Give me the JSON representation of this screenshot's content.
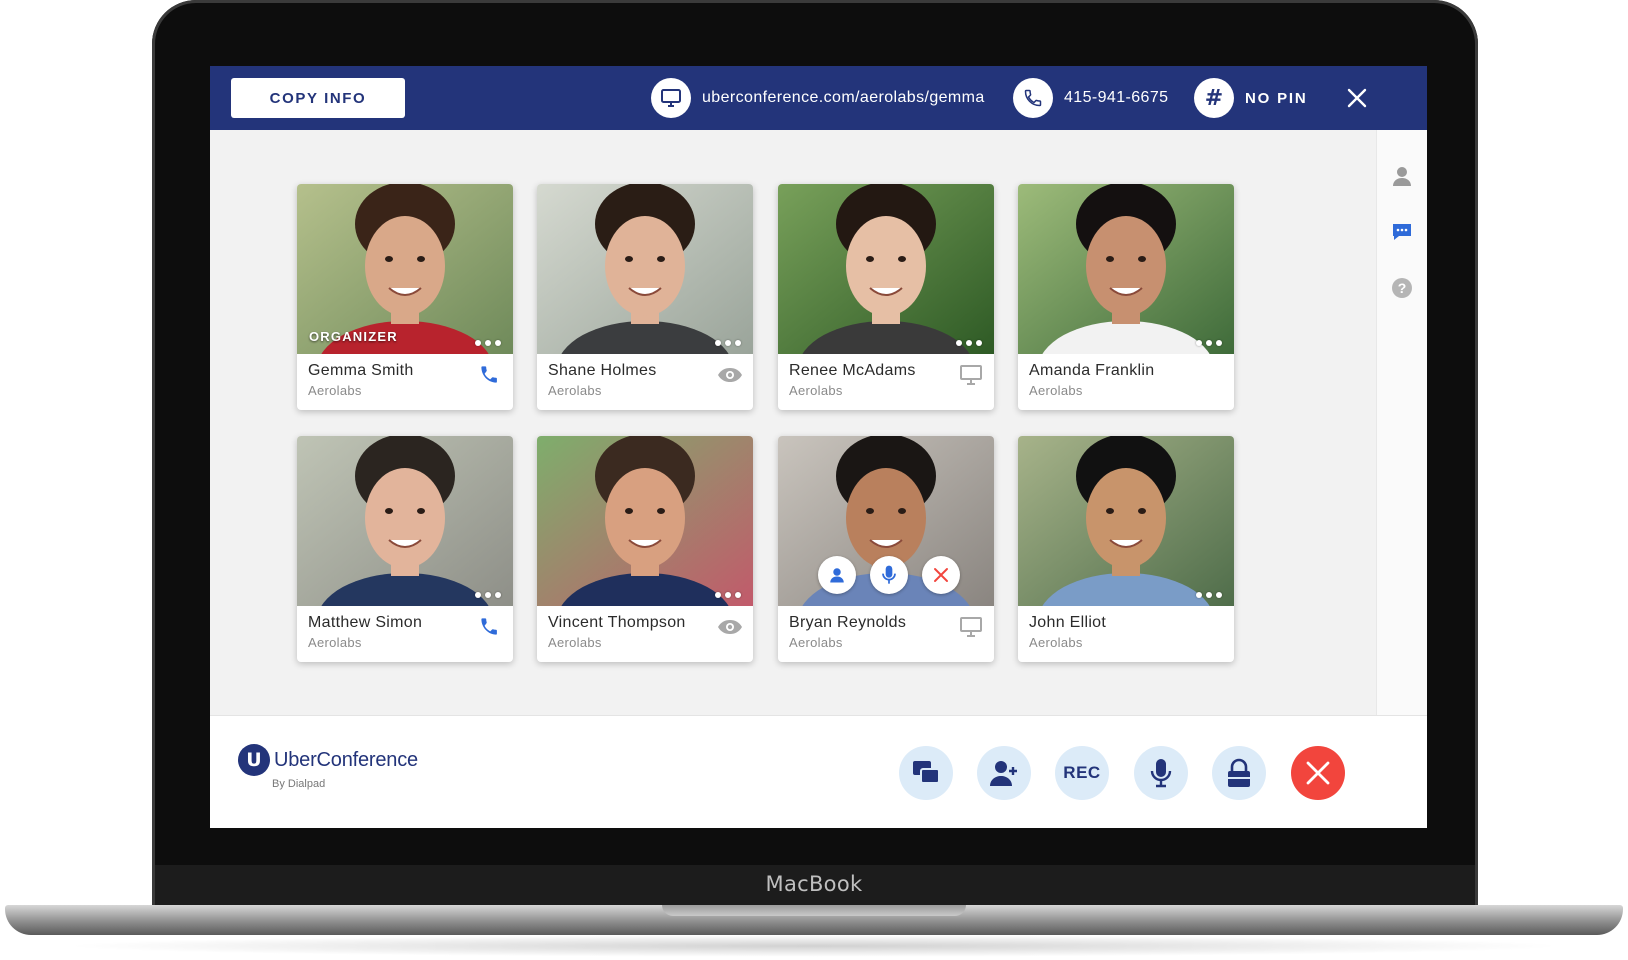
{
  "device": {
    "brand": "MacBook"
  },
  "topbar": {
    "copy_info_label": "COPY INFO",
    "url": "uberconference.com/aerolabs/gemma",
    "phone": "415-941-6675",
    "pin": "NO PIN"
  },
  "participants": [
    {
      "name": "Gemma Smith",
      "org": "Aerolabs",
      "badge": "ORGANIZER",
      "status": "phone"
    },
    {
      "name": "Shane Holmes",
      "org": "Aerolabs",
      "status": "view"
    },
    {
      "name": "Renee McAdams",
      "org": "Aerolabs",
      "status": "screen"
    },
    {
      "name": "Amanda Franklin",
      "org": "Aerolabs",
      "status": "none"
    },
    {
      "name": "Matthew Simon",
      "org": "Aerolabs",
      "status": "phone"
    },
    {
      "name": "Vincent Thompson",
      "org": "Aerolabs",
      "status": "view"
    },
    {
      "name": "Bryan Reynolds",
      "org": "Aerolabs",
      "status": "screen",
      "hover_actions": [
        "person-icon",
        "microphone-icon",
        "remove-icon"
      ]
    },
    {
      "name": "John Elliot",
      "org": "Aerolabs",
      "status": "none"
    }
  ],
  "bottombar": {
    "logo_badge": "U",
    "logo_name": "UberConference",
    "logo_sub": "By Dialpad",
    "rec_label": "REC"
  },
  "colors": {
    "brand_navy": "#23347a",
    "end_call_red": "#f2453d",
    "status_blue": "#2f6bd9",
    "control_bg": "#dcebf8"
  }
}
